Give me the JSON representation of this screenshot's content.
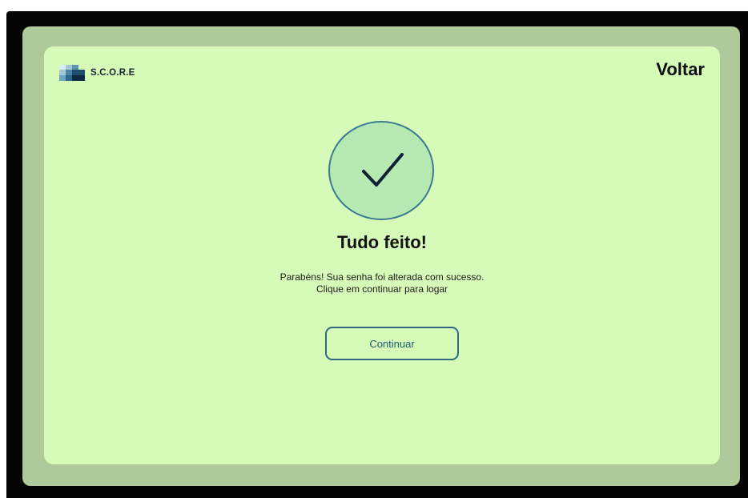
{
  "brand": {
    "name": "S.C.O.R.E",
    "logo_icon": "pixel-blocks-logo"
  },
  "nav": {
    "back_label": "Voltar"
  },
  "success": {
    "icon": "checkmark-icon",
    "title": "Tudo feito!",
    "message_line1": "Parabéns! Sua senha foi alterada com sucesso.",
    "message_line2": "Clique em continuar para logar"
  },
  "actions": {
    "continue_label": "Continuar"
  },
  "colors": {
    "outer_background": "#afc99a",
    "card_background": "#d6fbb9",
    "circle_fill": "#b6eab2",
    "accent": "#2f6982",
    "frame": "#050505"
  }
}
